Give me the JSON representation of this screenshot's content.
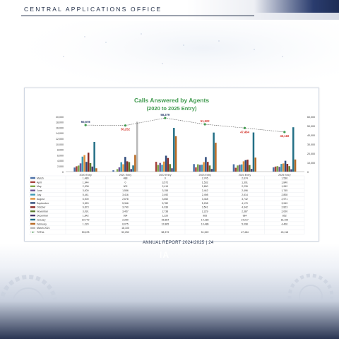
{
  "header": {
    "title": "CENTRAL APPLICATIONS OFFICE"
  },
  "footer": {
    "page_text": "ANNUAL REPORT 2024/2025 | 24",
    "logo_text": "IA"
  },
  "colors": {
    "navy": "#1d2a44",
    "total_line": "#3f9a4e",
    "title_green": "#3f9a4e",
    "total_label": "#d2342b"
  },
  "chart_data": {
    "type": "bar",
    "title": "Calls Answered by Agents",
    "subtitle": "(2020 to 2025 Entry)",
    "categories": [
      "2020 Entry",
      "2021 Entry",
      "2022 Entry",
      "2023 Entry",
      "2024 Entry",
      "2025 Entry"
    ],
    "ylim": [
      0,
      20000
    ],
    "y2lim": [
      0,
      60000
    ],
    "yticks": [
      "20,000",
      "18,000",
      "16,000",
      "14,000",
      "12,000",
      "10,000",
      "8,000",
      "6,000",
      "4,000",
      "2,000",
      "0"
    ],
    "y2ticks": [
      "60,000",
      "50,000",
      "40,000",
      "30,000",
      "20,000",
      "10,000",
      "0"
    ],
    "series": [
      {
        "name": "March",
        "color": "#4a6fa5",
        "values": [
          1480,
          488,
          0,
          2745,
          2674,
          1536
        ]
      },
      {
        "name": "April",
        "color": "#a5413b",
        "values": [
          1944,
          0,
          3572,
          1532,
          1391,
          1840
        ]
      },
      {
        "name": "May",
        "color": "#7fa64a",
        "values": [
          2208,
          902,
          2419,
          2650,
          2239,
          1992
        ]
      },
      {
        "name": "June",
        "color": "#6e5696",
        "values": [
          3000,
          1556,
          3155,
          2442,
          2496,
          1745
        ]
      },
      {
        "name": "July",
        "color": "#3f9ab5",
        "values": [
          5441,
          3416,
          2492,
          2498,
          2614,
          2808
        ]
      },
      {
        "name": "August",
        "color": "#e0903a",
        "values": [
          6000,
          2678,
          3652,
          3448,
          3742,
          2971
        ]
      },
      {
        "name": "September",
        "color": "#2e4a7a",
        "values": [
          3520,
          5346,
          5782,
          5298,
          4170,
          3949
        ]
      },
      {
        "name": "October",
        "color": "#8a2c28",
        "values": [
          6873,
          3740,
          4939,
          3541,
          4342,
          2823
        ]
      },
      {
        "name": "November",
        "color": "#5b7a30",
        "values": [
          3091,
          3457,
          2738,
          2229,
          2387,
          2000
        ]
      },
      {
        "name": "December",
        "color": "#4b3870",
        "values": [
          1842,
          934,
          1220,
          965,
          984,
          852
        ]
      },
      {
        "name": "January",
        "color": "#236f86",
        "values": [
          10779,
          2250,
          15884,
          14183,
          14217,
          16109
        ]
      },
      {
        "name": "February",
        "color": "#b86a24",
        "values": [
          1220,
          6075,
          12865,
          10486,
          5098,
          4406
        ]
      },
      {
        "name": "March 2021",
        "color": "#b8b8b8",
        "values": [
          null,
          18100,
          null,
          null,
          null,
          null
        ]
      }
    ],
    "total": {
      "name": "TOTAL",
      "values": [
        50678,
        50252,
        58379,
        51522,
        47484,
        43118
      ],
      "labels": [
        "50,678",
        "50,252",
        "58,379",
        "51,522",
        "47,484",
        "43,118"
      ]
    },
    "table": {
      "rows": [
        {
          "label": "March",
          "cells": [
            "1,480",
            "488",
            "0",
            "2,745",
            "2,674",
            "1,536"
          ]
        },
        {
          "label": "April",
          "cells": [
            "1,944",
            "0",
            "3,572",
            "1,532",
            "1,391",
            "1,840"
          ]
        },
        {
          "label": "May",
          "cells": [
            "2,208",
            "902",
            "2,419",
            "2,650",
            "2,239",
            "1,992"
          ]
        },
        {
          "label": "June",
          "cells": [
            "3,000",
            "1,556",
            "3,155",
            "2,442",
            "2,496",
            "1,745"
          ]
        },
        {
          "label": "July",
          "cells": [
            "5,441",
            "3,416",
            "2,492",
            "2,498",
            "2,614",
            "2,808"
          ]
        },
        {
          "label": "August",
          "cells": [
            "6,000",
            "2,678",
            "3,652",
            "3,448",
            "3,742",
            "2,971"
          ]
        },
        {
          "label": "September",
          "cells": [
            "3,520",
            "5,346",
            "5,782",
            "5,298",
            "4,170",
            "3,949"
          ]
        },
        {
          "label": "October",
          "cells": [
            "6,873",
            "3,740",
            "4,939",
            "3,541",
            "4,342",
            "2,823"
          ]
        },
        {
          "label": "November",
          "cells": [
            "3,091",
            "3,457",
            "2,738",
            "2,229",
            "2,387",
            "2,000"
          ]
        },
        {
          "label": "December",
          "cells": [
            "1,842",
            "934",
            "1,220",
            "965",
            "984",
            "852"
          ]
        },
        {
          "label": "January",
          "cells": [
            "10,779",
            "2,250",
            "15,884",
            "14,183",
            "14,217",
            "16,109"
          ]
        },
        {
          "label": "February",
          "cells": [
            "1,220",
            "6,075",
            "12,865",
            "10,486",
            "5,098",
            "4,406"
          ]
        },
        {
          "label": "March 2021",
          "cells": [
            "",
            "18,100",
            "",
            "",
            "",
            ""
          ]
        },
        {
          "label": "TOTAL",
          "cells": [
            "50,678",
            "50,252",
            "58,379",
            "51,522",
            "47,484",
            "43,118"
          ]
        }
      ]
    },
    "legend_position": "table-left",
    "grid": false
  }
}
